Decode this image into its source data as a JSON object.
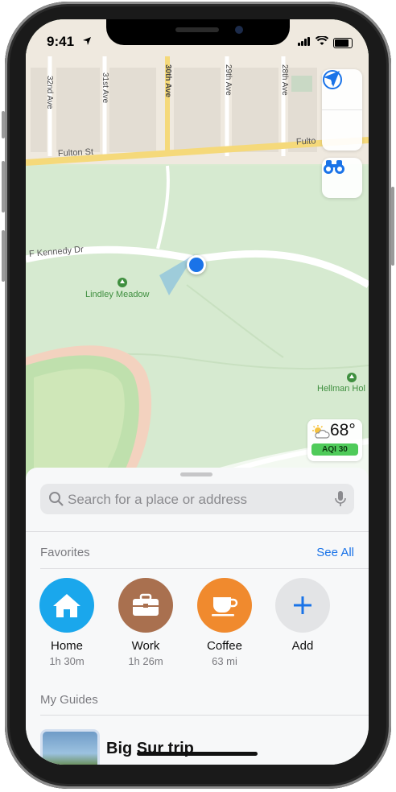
{
  "status_bar": {
    "time": "9:41"
  },
  "map": {
    "streets": [
      "32nd Ave",
      "31st Ave",
      "30th Ave",
      "29th Ave",
      "28th Ave",
      "Fulton St",
      "Fulto",
      "F Kennedy Dr"
    ],
    "pois": [
      "Lindley Meadow",
      "Hellman Hol"
    ],
    "controls": [
      "info-icon",
      "location-arrow-icon",
      "binoculars-icon"
    ],
    "weather": {
      "temperature": "68°",
      "aqi": "AQI 30"
    }
  },
  "sheet": {
    "search_placeholder": "Search for a place or address",
    "favorites_title": "Favorites",
    "see_all": "See All",
    "favorites": [
      {
        "name": "Home",
        "sub": "1h 30m",
        "color": "#1aa7ec",
        "icon": "house-icon"
      },
      {
        "name": "Work",
        "sub": "1h 26m",
        "color": "#a9704f",
        "icon": "briefcase-icon"
      },
      {
        "name": "Coffee",
        "sub": "63 mi",
        "color": "#f08a2e",
        "icon": "coffee-cup-icon"
      },
      {
        "name": "Add",
        "sub": "",
        "color": "#e3e4e6",
        "icon": "plus-icon"
      }
    ],
    "guides_title": "My Guides",
    "guide": {
      "title": "Big Sur trip"
    }
  },
  "colors": {
    "accent": "#1a73e8",
    "location_dot": "#1a73e8"
  }
}
